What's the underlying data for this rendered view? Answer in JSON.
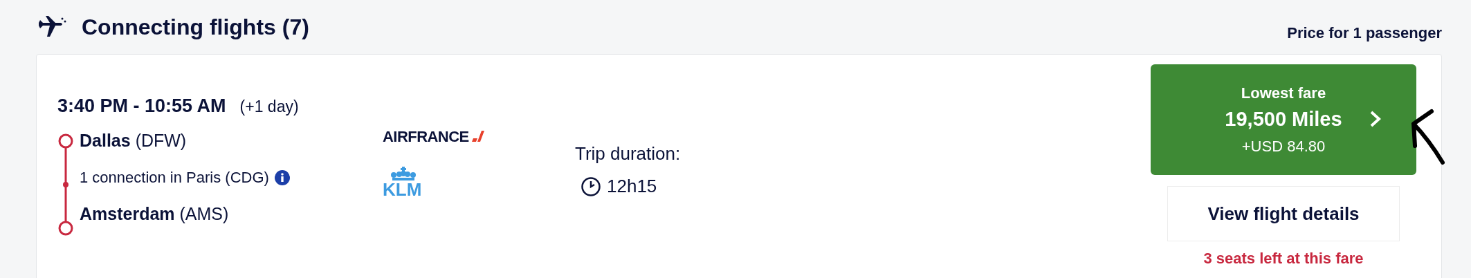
{
  "header": {
    "title": "Connecting flights (7)",
    "price_note": "Price for 1 passenger"
  },
  "flight": {
    "times": "3:40 PM - 10:55 AM",
    "day_offset": "(+1 day)",
    "stops": [
      {
        "kind": "endpoint",
        "city": "Dallas",
        "code": "(DFW)"
      },
      {
        "kind": "connection",
        "text": "1 connection in Paris (CDG)"
      },
      {
        "kind": "endpoint",
        "city": "Amsterdam",
        "code": "(AMS)"
      }
    ],
    "airlines": [
      {
        "kind": "airfrance",
        "name": "AIRFRANCE"
      },
      {
        "kind": "klm",
        "name": "KLM"
      }
    ],
    "duration_label": "Trip duration:",
    "duration": "12h15",
    "fare": {
      "label": "Lowest fare",
      "miles": "19,500 Miles",
      "cash": "+USD 84.80"
    },
    "details_button": "View flight details",
    "seats_note": "3 seats left at this fare"
  }
}
